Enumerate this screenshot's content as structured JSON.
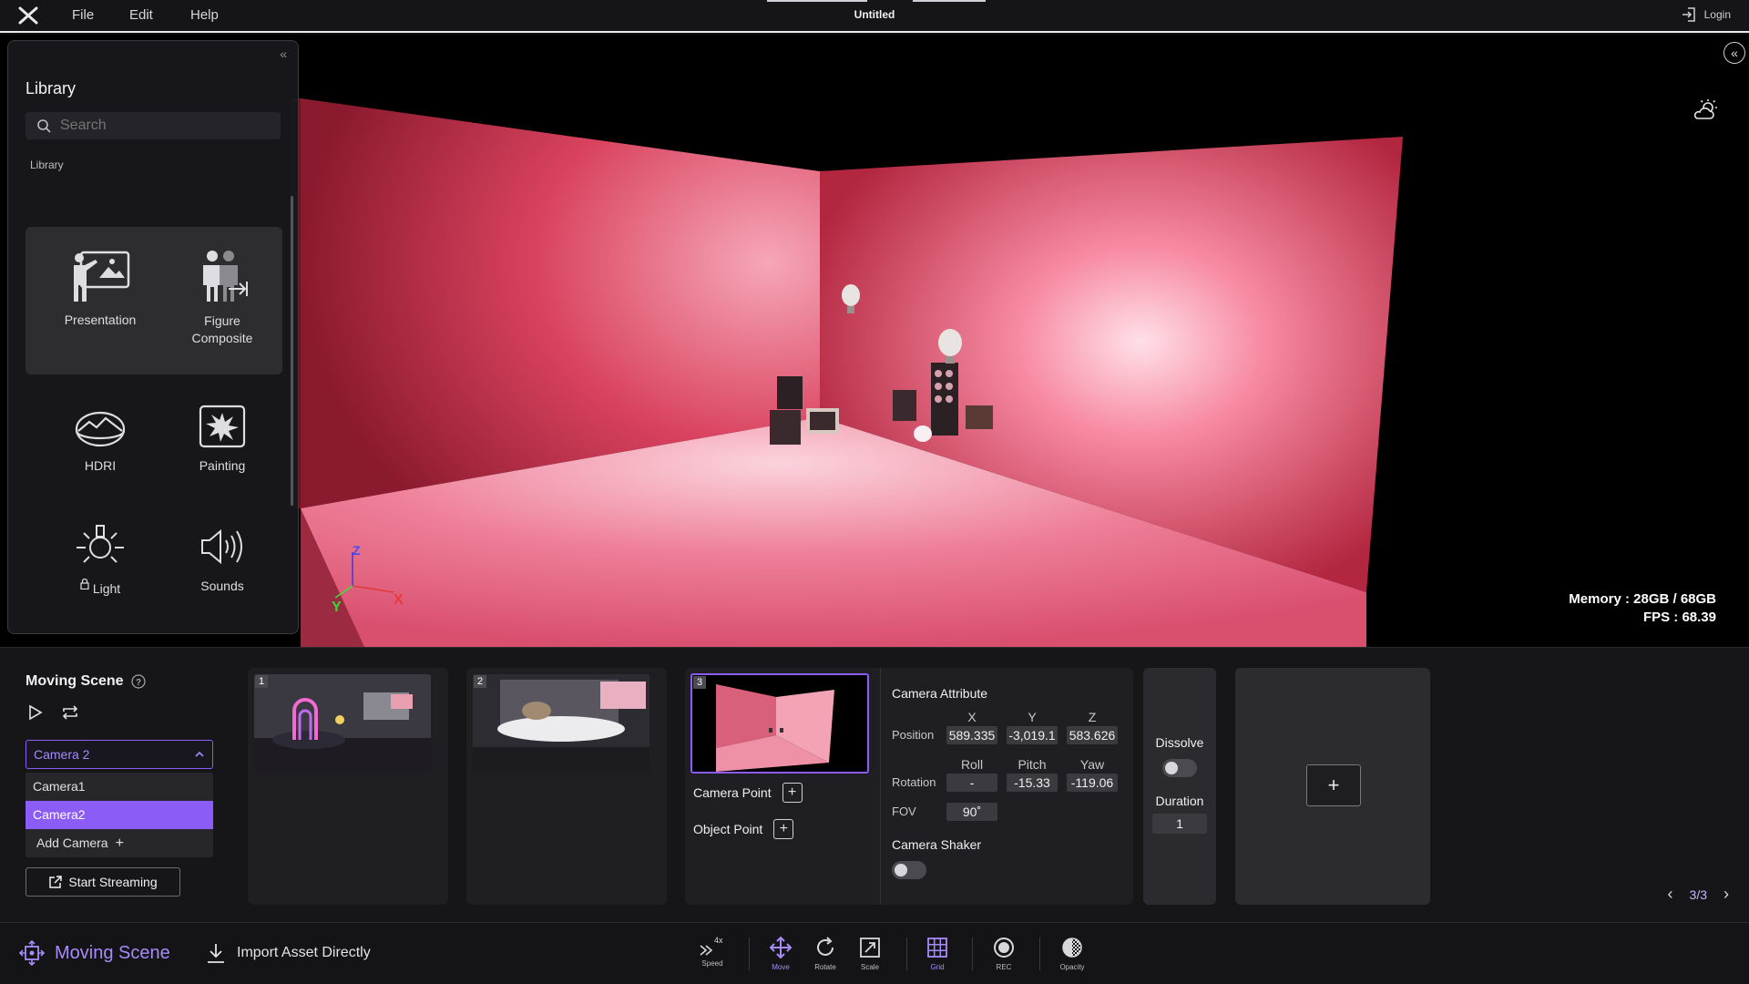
{
  "menu": {
    "file": "File",
    "edit": "Edit",
    "help": "Help"
  },
  "doc_title": "Untitled",
  "login": "Login",
  "stats": {
    "memory": "Memory : 28GB / 68GB",
    "fps": "FPS : 68.39"
  },
  "axes": {
    "x": "X",
    "y": "Y",
    "z": "Z"
  },
  "library": {
    "title": "Library",
    "search_placeholder": "Search",
    "subtitle": "Library",
    "items": [
      {
        "label": "Presentation",
        "icon": "presentation-icon"
      },
      {
        "label": "Figure\nComposite",
        "icon": "figure-composite-icon"
      },
      {
        "label": "HDRI",
        "icon": "hdri-icon"
      },
      {
        "label": "Painting",
        "icon": "painting-icon"
      },
      {
        "label": "Light",
        "icon": "light-icon",
        "locked": true
      },
      {
        "label": "Sounds",
        "icon": "sounds-icon"
      }
    ]
  },
  "moving_scene": {
    "title": "Moving Scene",
    "camera_selected": "Camera 2",
    "camera_options": [
      "Camera1",
      "Camera2"
    ],
    "camera_selected_index": 1,
    "add_camera": "Add Camera",
    "start_streaming": "Start Streaming",
    "shots": [
      "1",
      "2",
      "3"
    ],
    "active_shot": "3",
    "camera_point": "Camera Point",
    "object_point": "Object Point"
  },
  "camera_attribute": {
    "title": "Camera Attribute",
    "cols_pos": [
      "X",
      "Y",
      "Z"
    ],
    "position_label": "Position",
    "position": [
      "589.335",
      "-3,019.1",
      "583.626"
    ],
    "cols_rot": [
      "Roll",
      "Pitch",
      "Yaw"
    ],
    "rotation_label": "Rotation",
    "rotation": [
      "-",
      "-15.33",
      "-119.06"
    ],
    "fov_label": "FOV",
    "fov": "90˚",
    "shaker_label": "Camera Shaker"
  },
  "transition": {
    "dissolve": "Dissolve",
    "duration_label": "Duration",
    "duration": "1"
  },
  "pager": "3/3",
  "toolbar": {
    "moving_scene": "Moving Scene",
    "import": "Import Asset Directly",
    "speed_value": "4x",
    "speed": "Speed",
    "move": "Move",
    "rotate": "Rotate",
    "scale": "Scale",
    "grid": "Grid",
    "rec": "REC",
    "opacity": "Opacity"
  },
  "colors": {
    "accent": "#8b5cf6",
    "accent_light": "#a78bfa",
    "scene_pink": "#f06a8a"
  }
}
